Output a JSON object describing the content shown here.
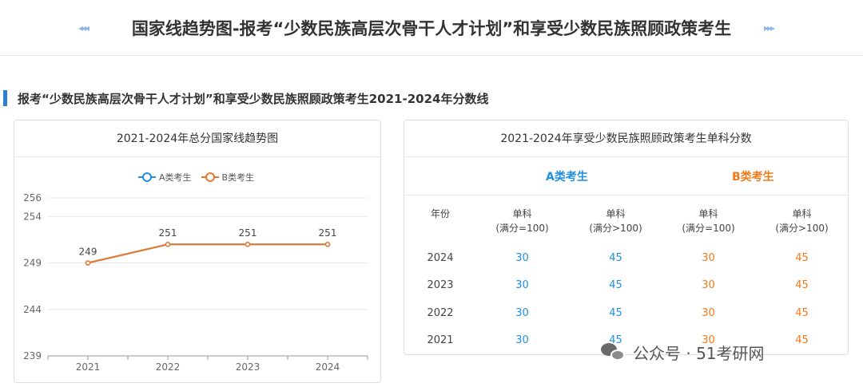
{
  "header": {
    "title": "国家线趋势图-报考“少数民族高层次骨干人才计划”和享受少数民族照顾政策考生",
    "left_arrows": "◂◂◂",
    "right_arrows": "▸▸▸"
  },
  "section": {
    "title": "报考“少数民族高层次骨干人才计划”和享受少数民族照顾政策考生2021-2024年分数线"
  },
  "chart_card": {
    "title": "2021-2024年总分国家线趋势图"
  },
  "chart_data": {
    "type": "line",
    "title": "2021-2024年总分国家线趋势图",
    "x": [
      "2021",
      "2022",
      "2023",
      "2024"
    ],
    "series": [
      {
        "name": "A类考生",
        "values": [
          249,
          251,
          251,
          251
        ],
        "color": "#1f8fe0"
      },
      {
        "name": "B类考生",
        "values": [
          249,
          251,
          251,
          251
        ],
        "color": "#e8782a"
      }
    ],
    "yticks": [
      239,
      244,
      249,
      254,
      256
    ],
    "ylim": [
      239,
      256
    ],
    "data_labels": [
      "249",
      "251",
      "251",
      "251"
    ],
    "grid": true,
    "legend_position": "top-center"
  },
  "table_card": {
    "title": "2021-2024年享受少数民族照顾政策考生单科分数",
    "group_a": "A类考生",
    "group_b": "B类考生",
    "col_year": "年份",
    "col_headers": [
      {
        "line1": "单科",
        "line2": "(满分=100)"
      },
      {
        "line1": "单科",
        "line2": "(满分>100)"
      },
      {
        "line1": "单科",
        "line2": "(满分=100)"
      },
      {
        "line1": "单科",
        "line2": "(满分>100)"
      }
    ],
    "rows": [
      {
        "year": "2024",
        "a100": "30",
        "a_gt100": "45",
        "b100": "30",
        "b_gt100": "45"
      },
      {
        "year": "2023",
        "a100": "30",
        "a_gt100": "45",
        "b100": "30",
        "b_gt100": "45"
      },
      {
        "year": "2022",
        "a100": "30",
        "a_gt100": "45",
        "b100": "30",
        "b_gt100": "45"
      },
      {
        "year": "2021",
        "a100": "30",
        "a_gt100": "45",
        "b100": "30",
        "b_gt100": "45"
      }
    ]
  },
  "watermark": {
    "text": "公众号 · 51考研网"
  }
}
